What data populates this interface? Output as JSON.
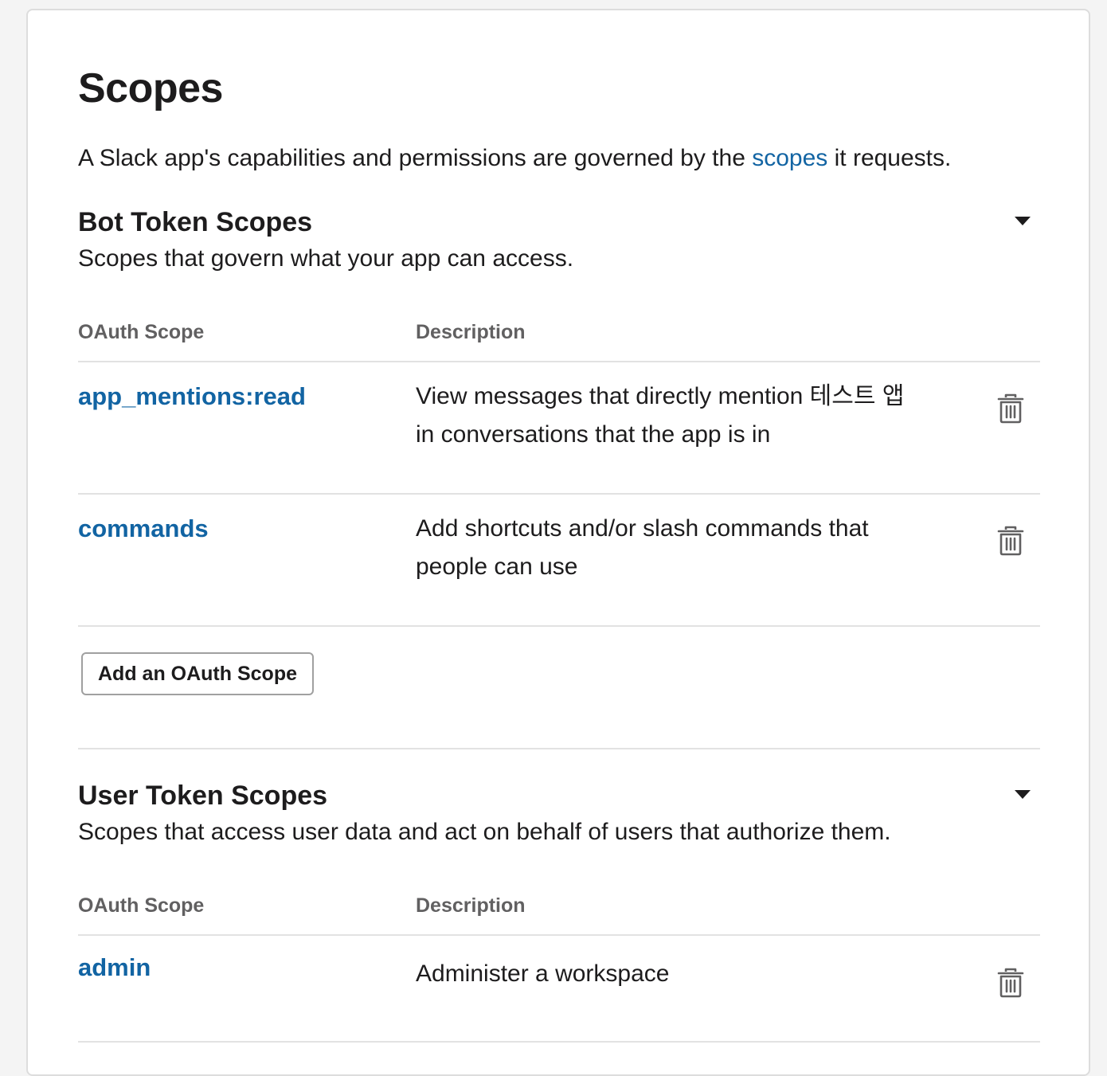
{
  "title": "Scopes",
  "intro": {
    "before": "A Slack app's capabilities and permissions are governed by the ",
    "link": "scopes",
    "after": " it requests."
  },
  "bot_section": {
    "title": "Bot Token Scopes",
    "subtitle": "Scopes that govern what your app can access.",
    "col_scope": "OAuth Scope",
    "col_desc": "Description",
    "rows": [
      {
        "scope": "app_mentions:read",
        "description": "View messages that directly mention 테스트 앱 in conversations that the app is in"
      },
      {
        "scope": "commands",
        "description": "Add shortcuts and/or slash commands that people can use"
      }
    ],
    "add_button": "Add an OAuth Scope"
  },
  "user_section": {
    "title": "User Token Scopes",
    "subtitle": "Scopes that access user data and act on behalf of users that authorize them.",
    "col_scope": "OAuth Scope",
    "col_desc": "Description",
    "rows": [
      {
        "scope": "admin",
        "description": "Administer a workspace"
      }
    ]
  },
  "icons": {
    "trash": "trash-icon",
    "collapse": "caret-down-icon"
  },
  "colors": {
    "link": "#1264a3",
    "text": "#1d1c1d",
    "muted": "#616061"
  }
}
